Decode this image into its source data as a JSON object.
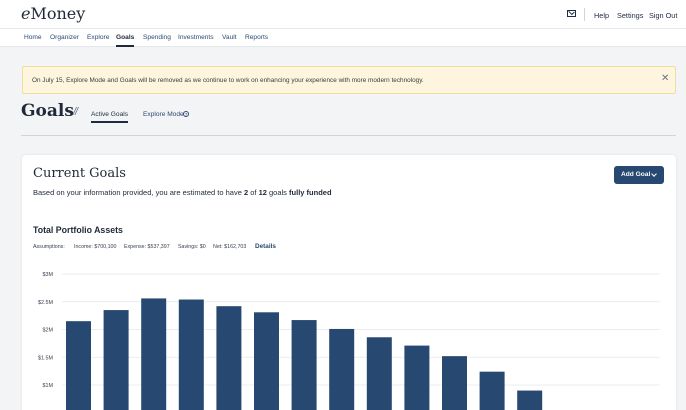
{
  "header": {
    "logo": "Money",
    "logo_prefix": "e",
    "links": [
      "Help",
      "Settings",
      "Sign Out"
    ],
    "mail_icon": "envelope-icon"
  },
  "nav": {
    "items": [
      "Home",
      "Organizer",
      "Explore",
      "Goals",
      "Spending",
      "Investments",
      "Vault",
      "Reports"
    ],
    "active": "Goals"
  },
  "banner": {
    "text": "On July 15, Explore Mode and Goals will be removed as we continue to work on enhancing your experience with more modern technology.",
    "close": "✕",
    "bg_color": "#fdf5dd"
  },
  "page": {
    "title": "Goals",
    "slash": "//",
    "tabs": [
      "Active Goals",
      "Explore Mode"
    ],
    "active_tab": "Active Goals",
    "help_glyph": "?"
  },
  "card": {
    "title": "Current Goals",
    "sub_prefix": "Based on your information provided, you are estimated to have ",
    "funded_count": "2",
    "sub_of": " of ",
    "total_count": "12",
    "sub_goals": " goals ",
    "sub_bold": "fully funded",
    "add_goal": "Add Goal"
  },
  "portfolio": {
    "title": "Total Portfolio Assets",
    "assumptions_label": "Assumptions:",
    "income": "Income: $700,100",
    "expense": "Expense: $537,397",
    "savings": "Savings: $0",
    "net": "Net: $162,703",
    "details": "Details"
  },
  "chart_data": {
    "type": "bar",
    "y_ticks": [
      "$3M",
      "$2.5M",
      "$2M",
      "$1.5M",
      "$1M"
    ],
    "y_tick_values": [
      3000000,
      2500000,
      2000000,
      1500000,
      1000000
    ],
    "values": [
      2150000,
      2350000,
      2560000,
      2540000,
      2420000,
      2310000,
      2170000,
      2010000,
      1860000,
      1710000,
      1520000,
      1240000,
      900000
    ],
    "bar_color": "#274870",
    "grid": true
  }
}
